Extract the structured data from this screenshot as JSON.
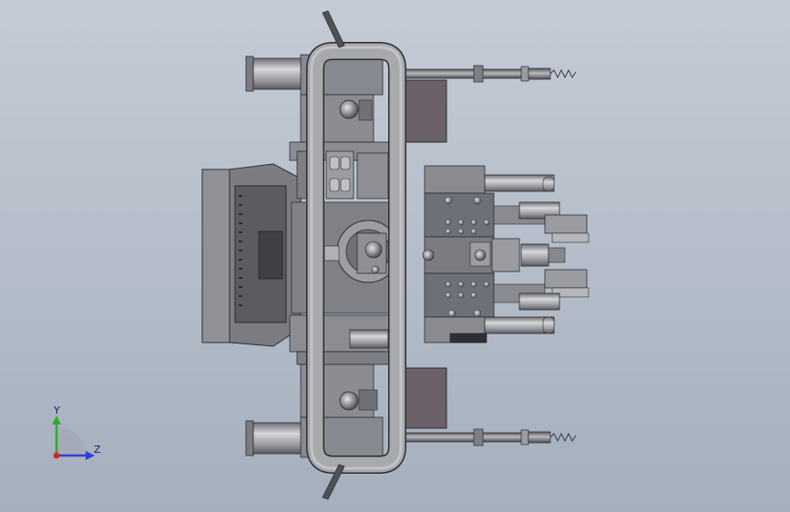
{
  "viewport": {
    "background_top": "#c4cbd6",
    "background_bottom": "#a5afbd"
  },
  "model": {
    "metal_color": "#8e9096",
    "metal_light": "#c9cacd",
    "metal_dark": "#4f5156",
    "plate_color": "#6e7078",
    "edge_color": "#2b2c30",
    "brown_plate_color": "#6b6168"
  },
  "triad": {
    "y_label": "Y",
    "z_label": "Z",
    "y_color": "#2faa2f",
    "z_color": "#2b3fd6",
    "origin_color": "#d42a2a"
  }
}
